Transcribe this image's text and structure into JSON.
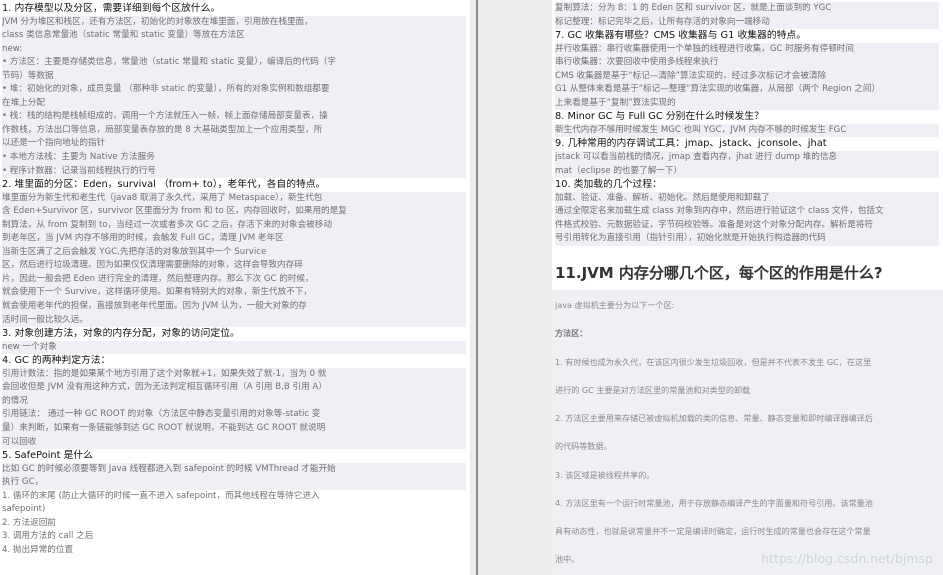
{
  "left": {
    "rows": [
      {
        "t": "1.  内存模型以及分区，需要详细到每个区放什么。",
        "cls": "h"
      },
      {
        "t": "JVM 分为堆区和栈区，还有方法区，初始化的对象放在堆里面，引用放在栈里面，",
        "cls": "hl"
      },
      {
        "t": "class 类信息常量池（static 常量和 static 变量）等放在方法区",
        "cls": "hl"
      },
      {
        "t": "new:",
        "cls": "hl"
      },
      {
        "t": "• 方法区：主要是存储类信息，常量池（static 常量和 static 变量），编译后的代码（字",
        "cls": "hl"
      },
      {
        "t": "  节码）等数据",
        "cls": "hl"
      },
      {
        "t": "• 堆：初始化的对象，成员变量  （那种非 static 的变量），所有的对象实例和数组都要",
        "cls": "hl"
      },
      {
        "t": "  在堆上分配",
        "cls": "hl"
      },
      {
        "t": "• 栈：栈的结构是栈帧组成的，调用一个方法就压入一帧，帧上面存储局部变量表，操",
        "cls": "hl"
      },
      {
        "t": "  作数栈，方法出口等信息，局部变量表存放的是 8 大基础类型加上一个应用类型，所",
        "cls": "hl"
      },
      {
        "t": "  以还是一个指向地址的指针",
        "cls": "hl"
      },
      {
        "t": "• 本地方法栈：主要为 Native 方法服务",
        "cls": "hl"
      },
      {
        "t": "• 程序计数器：记录当前线程执行的行号",
        "cls": "hl"
      },
      {
        "t": "        2.  堆里面的分区：Eden，survival  （from+ to），老年代，各自的特点。",
        "cls": "h"
      },
      {
        "t": "堆里面分为新生代和老生代（java8 取消了永久代，采用了 Metaspace），新生代包",
        "cls": "hl"
      },
      {
        "t": "含 Eden+Survivor 区，survivor 区里面分为 from 和 to 区，内存回收时，如果用的是复",
        "cls": "hl"
      },
      {
        "t": "制算法，从 from 复制到 to，当经过一次或者多次 GC 之后，存活下来的对象会被移动",
        "cls": "hl"
      },
      {
        "t": "到老年区，当 JVM 内存不够用的时候，会触发 Full GC，清理 JVM 老年区",
        "cls": "hl"
      },
      {
        "t": "当新生区满了之后会触发 YGC,先把存活的对象放到其中一个 Survice",
        "cls": "hl"
      },
      {
        "t": "区，然后进行垃圾清理。因为如果仅仅清理需要删除的对象，这样会导致内存碎",
        "cls": "hl"
      },
      {
        "t": "片，因此一般会把 Eden 进行完全的清理，然后整理内存。那么下次 GC 的时候，",
        "cls": "hl"
      },
      {
        "t": "就会使用下一个 Survive，这样循环使用。如果有特别大的对象，新生代放不下，",
        "cls": "hl"
      },
      {
        "t": "就会使用老年代的担保，直接放到老年代里面。因为 JVM  认为，一般大对象的存",
        "cls": "hl"
      },
      {
        "t": "活时间一般比较久远。",
        "cls": "hl"
      },
      {
        "t": "3.  对象创建方法，对象的内存分配，对象的访问定位。",
        "cls": "h"
      },
      {
        "t": "new 一个对象",
        "cls": "hl"
      },
      {
        "t": "4.  GC 的两种判定方法：",
        "cls": "h"
      },
      {
        "t": "引用计数法：指的是如果某个地方引用了这个对象就+1，如果失效了就-1，当为 0 就",
        "cls": "hl"
      },
      {
        "t": "会回收但是 JVM 没有用这种方式，因为无法判定相互循环引用（A 引用 B,B 引用 A）",
        "cls": "hl"
      },
      {
        "t": "的情况",
        "cls": "hl"
      },
      {
        "t": "引用链法：  通过一种 GC ROOT 的对象（方法区中静态变量引用的对象等-static 变",
        "cls": "hl"
      },
      {
        "t": "量）来判断，如果有一条链能够到达 GC ROOT 就说明，不能到达 GC ROOT 就说明",
        "cls": "hl"
      },
      {
        "t": "可以回收",
        "cls": "hl"
      },
      {
        "t": "5.  SafePoint 是什么",
        "cls": "h"
      },
      {
        "t": "比如 GC 的时候必须要等到 Java 线程都进入到 safepoint 的时候 VMThread 才能开始",
        "cls": "hl"
      },
      {
        "t": "执行 GC，",
        "cls": "hl"
      },
      {
        "t": "1.  循环的末尾 (防止大循环的时候一直不进入 safepoint，而其他线程在等待它进入",
        "cls": ""
      },
      {
        "t": "    safepoint)",
        "cls": ""
      },
      {
        "t": "2.  方法返回前",
        "cls": ""
      },
      {
        "t": "3.  调用方法的 call 之后",
        "cls": ""
      },
      {
        "t": "4.  抛出异常的位置",
        "cls": ""
      }
    ]
  },
  "right": {
    "rows": [
      {
        "t": "复制算法：分为 8：1 的 Eden 区和 survivor 区，就是上面谈到的 YGC",
        "cls": "hl"
      },
      {
        "t": "标记整理：标记完毕之后，让所有存活的对象向一端移动",
        "cls": "hl"
      },
      {
        "t": "7.  GC 收集器有哪些？CMS 收集器与 G1 收集器的特点。",
        "cls": "h"
      },
      {
        "t": "并行收集器：串行收集器使用一个单独的线程进行收集，GC 时服务有停顿时间",
        "cls": "hl"
      },
      {
        "t": "串行收集器：次要回收中使用多线程来执行",
        "cls": "hl"
      },
      {
        "t": "CMS 收集器是基于“标记—清除”算法实现的，经过多次标记才会被清除",
        "cls": "hl"
      },
      {
        "t": "G1 从整体来看是基于“标记—整理”算法实现的收集器，从局部（两个 Region 之间）",
        "cls": "hl"
      },
      {
        "t": "上来看是基于“复制”算法实现的",
        "cls": "hl"
      },
      {
        "t": "8.  Minor GC 与 Full GC 分别在什么时候发生？",
        "cls": "h"
      },
      {
        "t": "新生代内存不够用时候发生 MGC 也叫 YGC，JVM 内存不够的时候发生 FGC",
        "cls": "hl"
      },
      {
        "t": "9.  几种常用的内存调试工具：jmap、jstack、jconsole、jhat",
        "cls": "h"
      },
      {
        "t": "jstack 可以看当前栈的情况，jmap 查看内存，jhat 进行 dump 堆的信息",
        "cls": "hl"
      },
      {
        "t": "mat（eclipse 的也要了解一下）",
        "cls": "hl"
      },
      {
        "t": "10. 类加载的几个过程：",
        "cls": "h"
      },
      {
        "t": "加载、验证、准备、解析、初始化。然后是使用和卸载了",
        "cls": "hl"
      },
      {
        "t": "通过全限定名来加载生成 class 对象到内存中，然后进行验证这个 class 文件，包括文",
        "cls": "hl"
      },
      {
        "t": "件格式校验、元数据验证，字节码校验等。准备是对这个对象分配内存。解析是将符",
        "cls": "hl"
      },
      {
        "t": "号引用转化为直接引用（指针引用），初始化就是开始执行构造器的代码",
        "cls": "hl"
      }
    ],
    "title": "11.JVM 内存分哪几个区，每个区的作用是什么?",
    "answer": [
      {
        "t": "java 虚拟机主要分为以下一个区:",
        "cls": ""
      },
      {
        "t": "方法区：",
        "cls": "bold"
      },
      {
        "t": "1. 有时候也成为永久代，在该区内很少发生垃圾回收，但是并不代表不发生 GC，在这里",
        "cls": ""
      },
      {
        "t": "进行的 GC 主要是对方法区里的常量池和对类型的卸载",
        "cls": ""
      },
      {
        "t": "2. 方法区主要用来存储已被虚拟机加载的类的信息、常量、静态变量和即时编译器编译后",
        "cls": ""
      },
      {
        "t": "的代码等数据。",
        "cls": ""
      },
      {
        "t": "3. 该区域是被线程共享的。",
        "cls": ""
      },
      {
        "t": "4. 方法区里有一个运行时常量池，用于存放静态编译产生的字面量和符号引用。该常量池",
        "cls": ""
      },
      {
        "t": "具有动态性，也就是说常量并不一定是编译时确定，运行时生成的常量也会存在这个常量",
        "cls": ""
      },
      {
        "t": "池中。",
        "cls": ""
      }
    ]
  },
  "watermark": "https://blog.csdn.net/bjmsp"
}
